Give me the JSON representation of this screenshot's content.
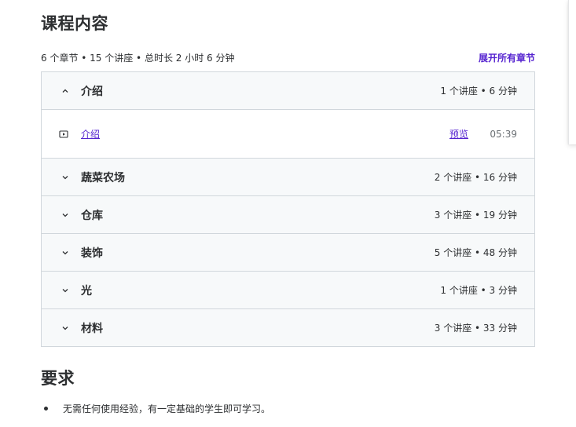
{
  "course_content": {
    "title": "课程内容",
    "summary": "6 个章节 • 15 个讲座 • 总时长 2 小时 6 分钟",
    "expand_all_label": "展开所有章节"
  },
  "sections": [
    {
      "title": "介绍",
      "meta": "1 个讲座 • 6 分钟",
      "expanded": true,
      "lectures": [
        {
          "title": "介绍",
          "preview_label": "预览",
          "duration": "05:39"
        }
      ]
    },
    {
      "title": "蔬菜农场",
      "meta": "2 个讲座 • 16 分钟",
      "expanded": false
    },
    {
      "title": "仓库",
      "meta": "3 个讲座 • 19 分钟",
      "expanded": false
    },
    {
      "title": "装饰",
      "meta": "5 个讲座 • 48 分钟",
      "expanded": false
    },
    {
      "title": "光",
      "meta": "1 个讲座 • 3 分钟",
      "expanded": false
    },
    {
      "title": "材料",
      "meta": "3 个讲座 • 33 分钟",
      "expanded": false
    }
  ],
  "requirements": {
    "title": "要求",
    "items": [
      "无需任何使用经验，有一定基础的学生即可学习。"
    ]
  },
  "icons": {
    "expanded": "chevron-up-icon",
    "collapsed": "chevron-down-icon",
    "lecture": "video-play-icon"
  },
  "colors": {
    "accent": "#5624d0",
    "text": "#2d2f31",
    "muted": "#6a6f73",
    "section_bg": "#f7f9fa",
    "border": "#d1d7dc"
  }
}
